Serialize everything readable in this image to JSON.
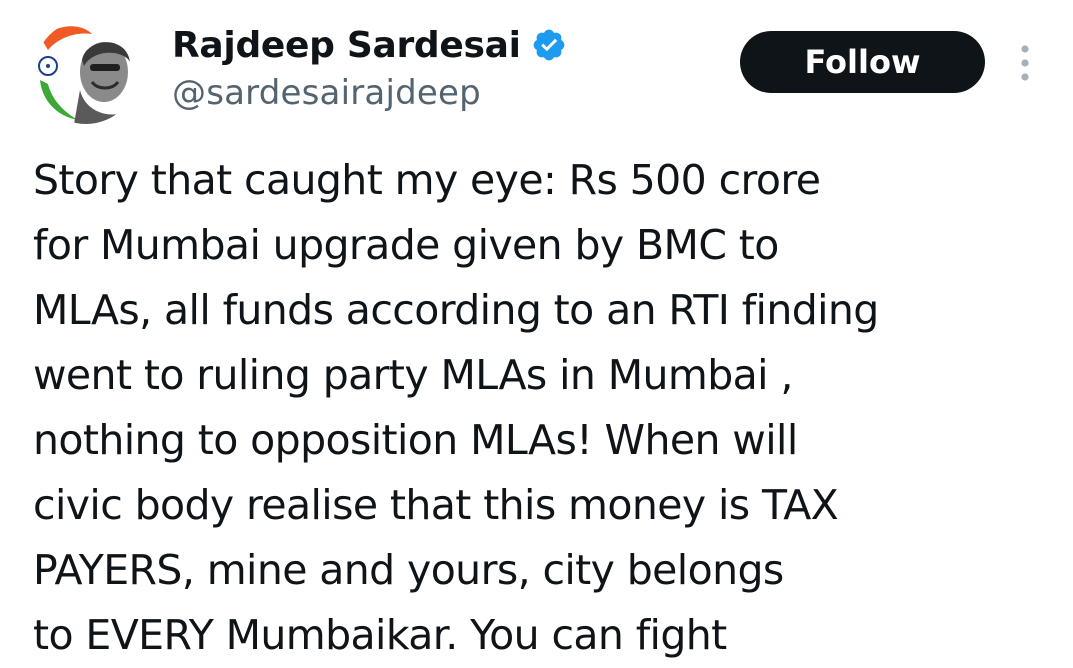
{
  "author": {
    "display_name": "Rajdeep Sardesai",
    "handle": "@sardesairajdeep",
    "verified": true,
    "verified_icon": "verified-badge-icon",
    "avatar_icon": "profile-photo"
  },
  "actions": {
    "follow_label": "Follow",
    "more_icon": "more-options-icon"
  },
  "tweet": {
    "lines": [
      "Story that caught my eye: Rs 500 crore",
      "for Mumbai upgrade given by BMC to",
      "MLAs, all funds according to an RTI finding",
      "went to ruling party MLAs in Mumbai ,",
      "nothing to opposition MLAs! When will",
      "civic body realise that this money is TAX",
      "PAYERS, mine and yours, city belongs",
      "to EVERY Mumbaikar. You can fight"
    ]
  },
  "colors": {
    "text": "#0f1419",
    "secondary": "#536471",
    "verified_blue": "#1d9bf0",
    "follow_bg": "#0f1419",
    "follow_text": "#ffffff",
    "more_icon": "#a6b0b8"
  }
}
